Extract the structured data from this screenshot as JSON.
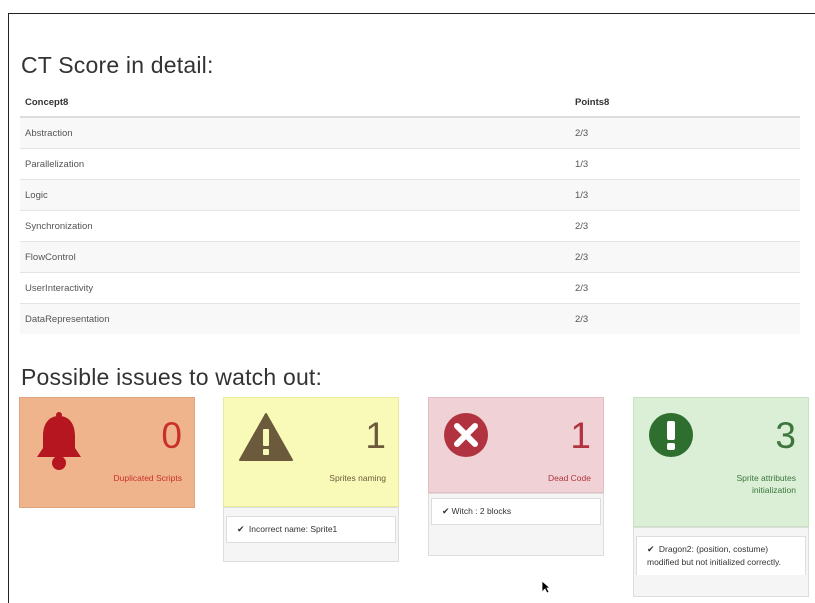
{
  "ct_section": {
    "title": "CT Score in detail:",
    "headers": {
      "concept": "Concept8",
      "points": "Points8"
    },
    "rows": [
      {
        "concept": "Abstraction",
        "points": "2/3"
      },
      {
        "concept": "Parallelization",
        "points": "1/3"
      },
      {
        "concept": "Logic",
        "points": "1/3"
      },
      {
        "concept": "Synchronization",
        "points": "2/3"
      },
      {
        "concept": "FlowControl",
        "points": "2/3"
      },
      {
        "concept": "UserInteractivity",
        "points": "2/3"
      },
      {
        "concept": "DataRepresentation",
        "points": "2/3"
      }
    ]
  },
  "issues_section": {
    "title": "Possible issues to watch out:",
    "cards": [
      {
        "icon": "bell-icon",
        "count": "0",
        "label": "Duplicated Scripts",
        "color": "#c9302c",
        "bg": "#f0b48d",
        "items": []
      },
      {
        "icon": "warning-triangle-icon",
        "count": "1",
        "label": "Sprites naming",
        "color": "#6b5a3b",
        "bg": "#fafab8",
        "items": [
          "Incorrect name: Sprite1"
        ]
      },
      {
        "icon": "x-circle-icon",
        "count": "1",
        "label": "Dead Code",
        "color": "#b0333f",
        "bg": "#f0d2d6",
        "items": [
          "Witch : 2 blocks"
        ]
      },
      {
        "icon": "exclamation-circle-icon",
        "count": "3",
        "label": "Sprite attributes initialization",
        "color": "#3c763d",
        "bg": "#daefd5",
        "items": [
          "Dragon2: (position, costume) modified but not initialized correctly."
        ]
      }
    ]
  }
}
